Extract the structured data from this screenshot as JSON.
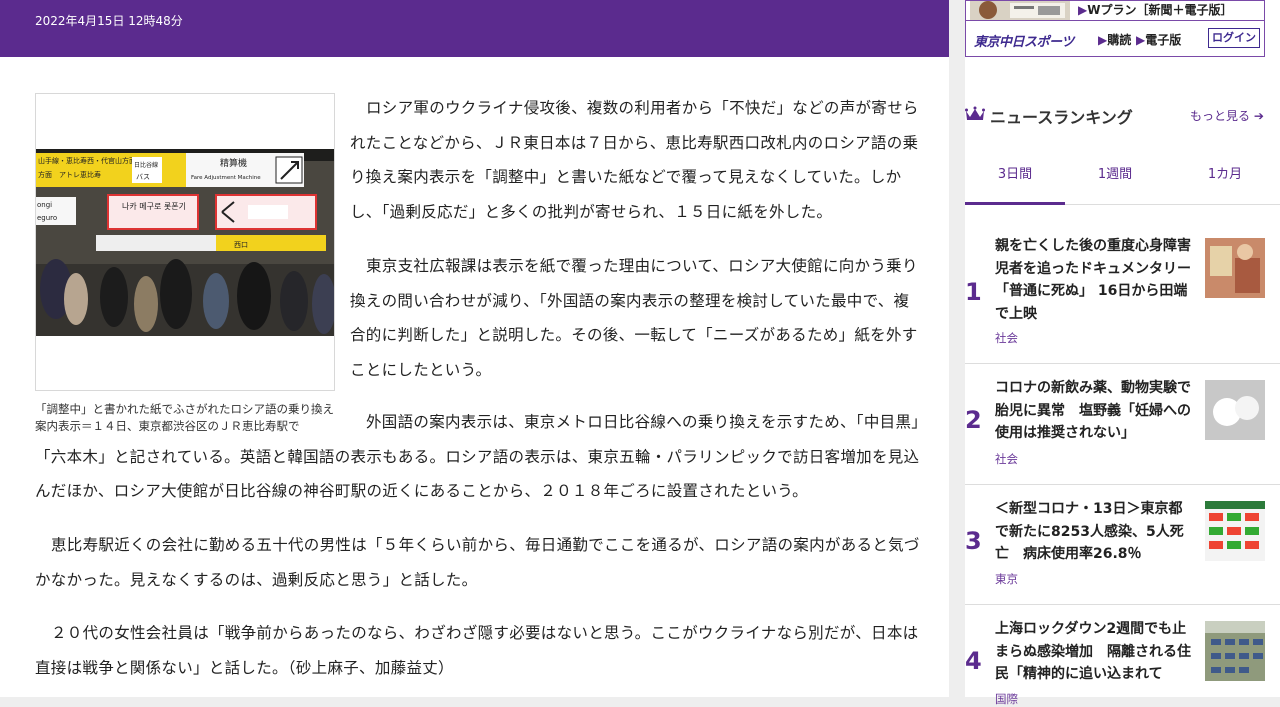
{
  "article": {
    "date": "2022年4月15日 12時48分",
    "caption": "「調整中」と書かれた紙でふさがれたロシア語の乗り換え案内表示＝１４日、東京都渋谷区のＪＲ恵比寿駅で",
    "photo_signs": {
      "ebisu_line": "山手線・恵比寿西・代官山方面",
      "atre": "方面　アトレ恵比寿",
      "hibiya": "日比谷線",
      "bus": "バス",
      "fare": "精算機",
      "fare_en": "Fare Adjustment Machine",
      "korean": "나카 메구로 롯폰기",
      "west": "西口",
      "ongi": "ongi",
      "eguro": "eguro"
    },
    "p1": "ロシア軍のウクライナ侵攻後、複数の利用者から「不快だ」などの声が寄せられたことなどから、ＪＲ東日本は７日から、恵比寿駅西口改札内のロシア語の乗り換え案内表示を「調整中」と書いた紙などで覆って見えなくしていた。しかし、「過剰反応だ」と多くの批判が寄せられ、１５日に紙を外した。",
    "p2": "東京支社広報課は表示を紙で覆った理由について、ロシア大使館に向かう乗り換えの問い合わせが減り、「外国語の案内表示の整理を検討していた最中で、複合的に判断した」と説明した。その後、一転して「ニーズがあるため」紙を外すことにしたという。",
    "p3": "外国語の案内表示は、東京メトロ日比谷線への乗り換えを示すため、「中目黒」「六本木」と記されている。英語と韓国語の表示もある。ロシア語の表示は、東京五輪・パラリンピックで訪日客増加を見込んだほか、ロシア大使館が日比谷線の神谷町駅の近くにあることから、２０１８年ごろに設置されたという。",
    "p4": "恵比寿駅近くの会社に勤める五十代の男性は「５年くらい前から、毎日通勤でここを通るが、ロシア語の案内があると気づかなかった。見えなくするのは、過剰反応と思う」と話した。",
    "p5": "２０代の女性会社員は「戦争前からあったのなら、わざわざ隠す必要はないと思う。ここがウクライナなら別だが、日本は直接は戦争と関係ない」と話した。（砂上麻子、加藤益丈）"
  },
  "ad": {
    "plan": "Wプラン［新聞＋電子版］",
    "logo": "東京中日スポーツ",
    "subscribe": "購読",
    "digital": "電子版",
    "login": "ログイン"
  },
  "ranking": {
    "title": "ニュースランキング",
    "more": "もっと見る",
    "tabs": [
      "3日間",
      "1週間",
      "1カ月"
    ],
    "items": [
      {
        "rank": "1",
        "title": "親を亡くした後の重度心身障害児者を追ったドキュメンタリー「普通に死ぬ」 16日から田端で上映",
        "category": "社会"
      },
      {
        "rank": "2",
        "title": "コロナの新飲み薬、動物実験で胎児に異常　塩野義「妊婦への使用は推奨されない」",
        "category": "社会"
      },
      {
        "rank": "3",
        "title": "＜新型コロナ・13日＞東京都で新たに8253人感染、5人死亡　病床使用率26.8％",
        "category": "東京"
      },
      {
        "rank": "4",
        "title": "上海ロックダウン2週間でも止まらぬ感染増加　隔離される住民「精神的に追い込まれて",
        "category": "国際"
      }
    ]
  },
  "colors": {
    "brand": "#5b2b8e",
    "accent_text": "#6b3a9a"
  }
}
